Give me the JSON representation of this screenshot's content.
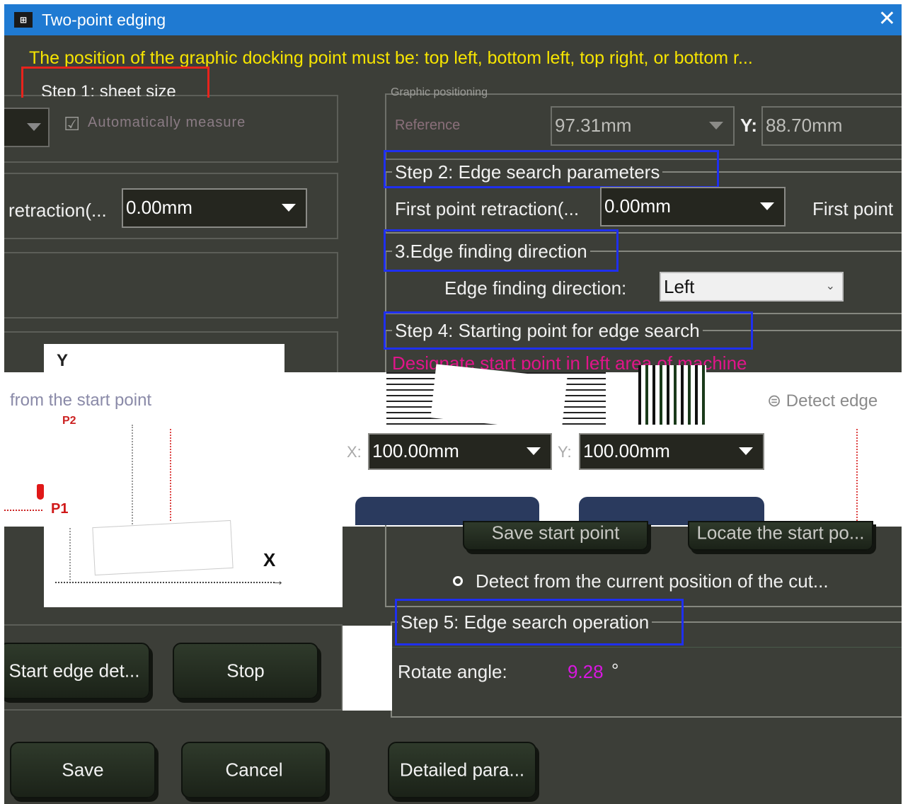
{
  "window": {
    "title": "Two-point edging",
    "icon": "edge-tool-icon",
    "close_icon": "close-icon"
  },
  "warning": "The position of the graphic docking point must be: top left, bottom left, top right, or bottom r...",
  "step1": {
    "label": "Step 1: sheet size",
    "checkbox_label": "Automatically measure"
  },
  "positioning": {
    "label": "Graphic positioning",
    "x_label": "Reference",
    "x_value": "97.31mm",
    "y_label": "Y:",
    "y_value": "88.70mm"
  },
  "left_retraction": {
    "label": "retraction(...",
    "value": "0.00mm"
  },
  "step2": {
    "label": "Step 2: Edge search parameters",
    "first_retraction_label": "First point retraction(...",
    "first_retraction_value": "0.00mm",
    "first_point_label": "First point"
  },
  "step3": {
    "label": "3.Edge finding direction",
    "direction_label": "Edge finding direction:",
    "direction_value": "Left"
  },
  "step4": {
    "label": "Step 4: Starting point for edge search",
    "hint": "Designate start point in left area of machine"
  },
  "start_options": {
    "from_start_label": "from the start point",
    "detect_edge_label": "Detect edge",
    "detect_current_label": "Detect from the current position of the cut..."
  },
  "coords": {
    "x_label": "X:",
    "x_value": "100.00mm",
    "y_label": "Y:",
    "y_value": "100.00mm"
  },
  "start_buttons": {
    "save_start": "Save start point",
    "locate_start": "Locate the start po..."
  },
  "diagram": {
    "y_axis": "Y",
    "x_axis": "X",
    "p1": "P1",
    "p2": "P2"
  },
  "step5": {
    "label": "Step 5: Edge search operation",
    "rotate_label": "Rotate angle:",
    "rotate_value": "9.28",
    "rotate_unit": "°"
  },
  "actions": {
    "start": "Start edge det...",
    "stop": "Stop",
    "save": "Save",
    "cancel": "Cancel",
    "detailed": "Detailed para..."
  },
  "colors": {
    "titlebar": "#1f7ad2",
    "warning": "#f6e400",
    "step_border": "#1f2ff0",
    "step1_border": "#e8231c",
    "hint": "#e0158a",
    "angle": "#d817e0",
    "background": "#3c3e38"
  }
}
